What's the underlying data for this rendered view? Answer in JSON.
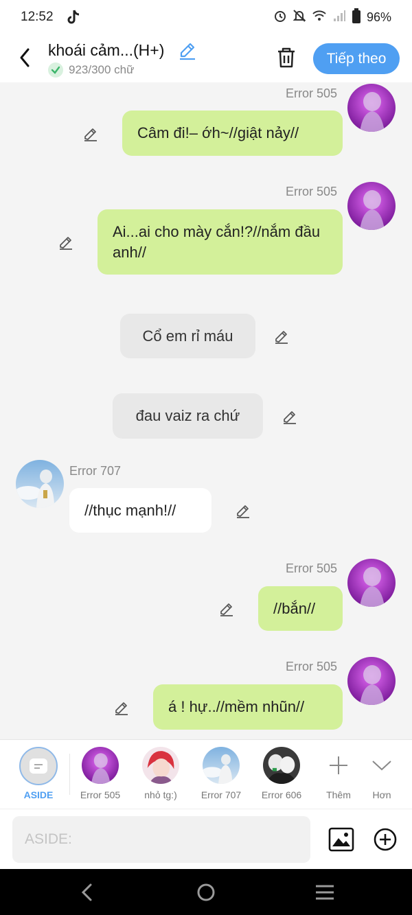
{
  "status_bar": {
    "time": "12:52",
    "battery": "96%"
  },
  "header": {
    "title": "khoái cảm...(H+)",
    "word_count": "923/300 chữ",
    "next_label": "Tiếp theo"
  },
  "messages": [
    {
      "speaker": "Error 505",
      "text": "Câm đi!– ớh~//giật nảy//"
    },
    {
      "speaker": "Error 505",
      "text": "Ai...ai cho mày cắn!?//nắm đầu anh//"
    },
    {
      "speaker": "",
      "text": "Cổ em rỉ máu"
    },
    {
      "speaker": "",
      "text": "đau vaiz ra chứ"
    },
    {
      "speaker": "Error 707",
      "text": "//thục mạnh!//"
    },
    {
      "speaker": "Error 505",
      "text": "//bắn//"
    },
    {
      "speaker": "Error 505",
      "text": "á ! hự..//mềm nhũn//"
    }
  ],
  "characters": [
    {
      "label": "ASIDE"
    },
    {
      "label": "Error 505"
    },
    {
      "label": "nhỏ tg:)"
    },
    {
      "label": "Error 707"
    },
    {
      "label": "Error 606"
    },
    {
      "label": "Thêm"
    },
    {
      "label": "Hơn"
    }
  ],
  "input": {
    "placeholder": "ASIDE:"
  },
  "colors": {
    "accent": "#4f9ff2",
    "bubble_green": "#d3f09a",
    "aside_label": "#4f9ff2"
  },
  "icons": [
    "back-arrow-icon",
    "pencil-icon",
    "check-icon",
    "trash-icon",
    "image-icon",
    "plus-circle-icon",
    "tiktok-icon",
    "alarm-icon",
    "mute-icon",
    "wifi-icon",
    "signal-icon",
    "battery-icon"
  ]
}
